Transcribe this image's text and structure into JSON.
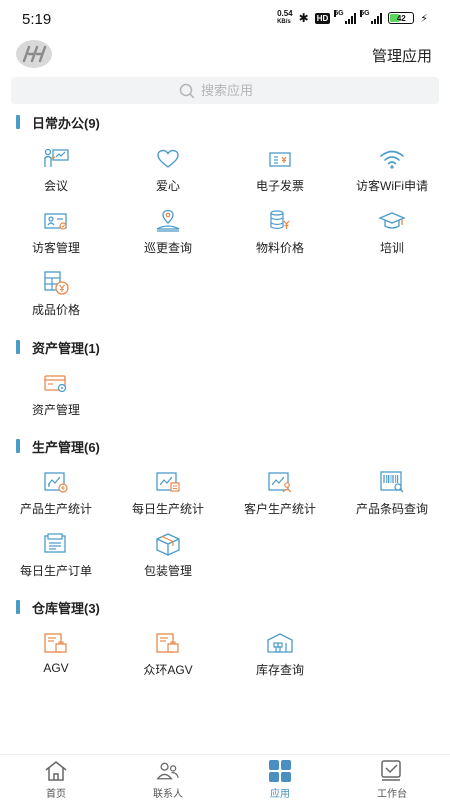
{
  "status": {
    "time": "5:19",
    "net_speed_value": "0.54",
    "net_speed_unit": "KB/s",
    "hd": "HD",
    "sig1": "5G",
    "sig2": "5G",
    "battery": "42"
  },
  "header": {
    "manage_label": "管理应用"
  },
  "search": {
    "placeholder": "搜索应用"
  },
  "sections": [
    {
      "title": "日常办公(9)",
      "items": [
        {
          "label": "会议",
          "icon": "meeting-icon"
        },
        {
          "label": "爱心",
          "icon": "heart-icon"
        },
        {
          "label": "电子发票",
          "icon": "invoice-icon"
        },
        {
          "label": "访客WiFi申请",
          "icon": "wifi-icon"
        },
        {
          "label": "访客管理",
          "icon": "visitor-card-icon"
        },
        {
          "label": "巡更查询",
          "icon": "patrol-location-icon"
        },
        {
          "label": "物料价格",
          "icon": "material-price-icon"
        },
        {
          "label": "培训",
          "icon": "graduation-cap-icon"
        },
        {
          "label": "成品价格",
          "icon": "product-price-icon"
        }
      ]
    },
    {
      "title": "资产管理(1)",
      "items": [
        {
          "label": "资产管理",
          "icon": "asset-card-icon"
        }
      ]
    },
    {
      "title": "生产管理(6)",
      "items": [
        {
          "label": "产品生产统计",
          "icon": "product-stats-icon"
        },
        {
          "label": "每日生产统计",
          "icon": "daily-stats-icon"
        },
        {
          "label": "客户生产统计",
          "icon": "customer-stats-icon"
        },
        {
          "label": "产品条码查询",
          "icon": "barcode-search-icon"
        },
        {
          "label": "每日生产订单",
          "icon": "daily-order-icon"
        },
        {
          "label": "包装管理",
          "icon": "package-box-icon"
        }
      ]
    },
    {
      "title": "仓库管理(3)",
      "items": [
        {
          "label": "AGV",
          "icon": "agv-icon"
        },
        {
          "label": "众环AGV",
          "icon": "agv-icon"
        },
        {
          "label": "库存查询",
          "icon": "warehouse-icon"
        }
      ]
    }
  ],
  "tabbar": {
    "tabs": [
      {
        "label": "首页",
        "icon": "home-icon"
      },
      {
        "label": "联系人",
        "icon": "contacts-icon"
      },
      {
        "label": "应用",
        "icon": "apps-grid-icon"
      },
      {
        "label": "工作台",
        "icon": "workbench-check-icon"
      }
    ]
  },
  "colors": {
    "teal": "#4a9bc8",
    "orange": "#e8884a",
    "active_tab": "#4a8fbf"
  }
}
